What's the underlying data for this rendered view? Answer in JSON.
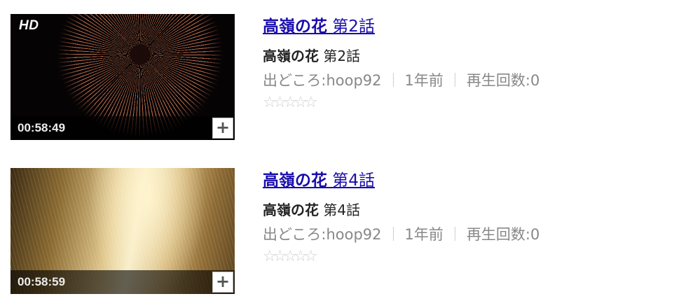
{
  "videos": [
    {
      "hd_label": "HD",
      "duration": "00:58:49",
      "add_label": "+",
      "title_bold": "高嶺の花",
      "title_rest": " 第2話",
      "subtitle_bold": "高嶺の花",
      "subtitle_rest": " 第2話",
      "source": "出どころ:hoop92",
      "age": "1年前",
      "views": "再生回数:0",
      "stars": "☆☆☆☆☆",
      "rating": 0
    },
    {
      "duration": "00:58:59",
      "add_label": "+",
      "title_bold": "高嶺の花",
      "title_rest": " 第4話",
      "subtitle_bold": "高嶺の花",
      "subtitle_rest": " 第4話",
      "source": "出どころ:hoop92",
      "age": "1年前",
      "views": "再生回数:0",
      "stars": "☆☆☆☆☆",
      "rating": 0
    }
  ],
  "colors": {
    "link": "#1a0dab",
    "meta": "#888888",
    "star_empty": "#cfcfcf"
  }
}
